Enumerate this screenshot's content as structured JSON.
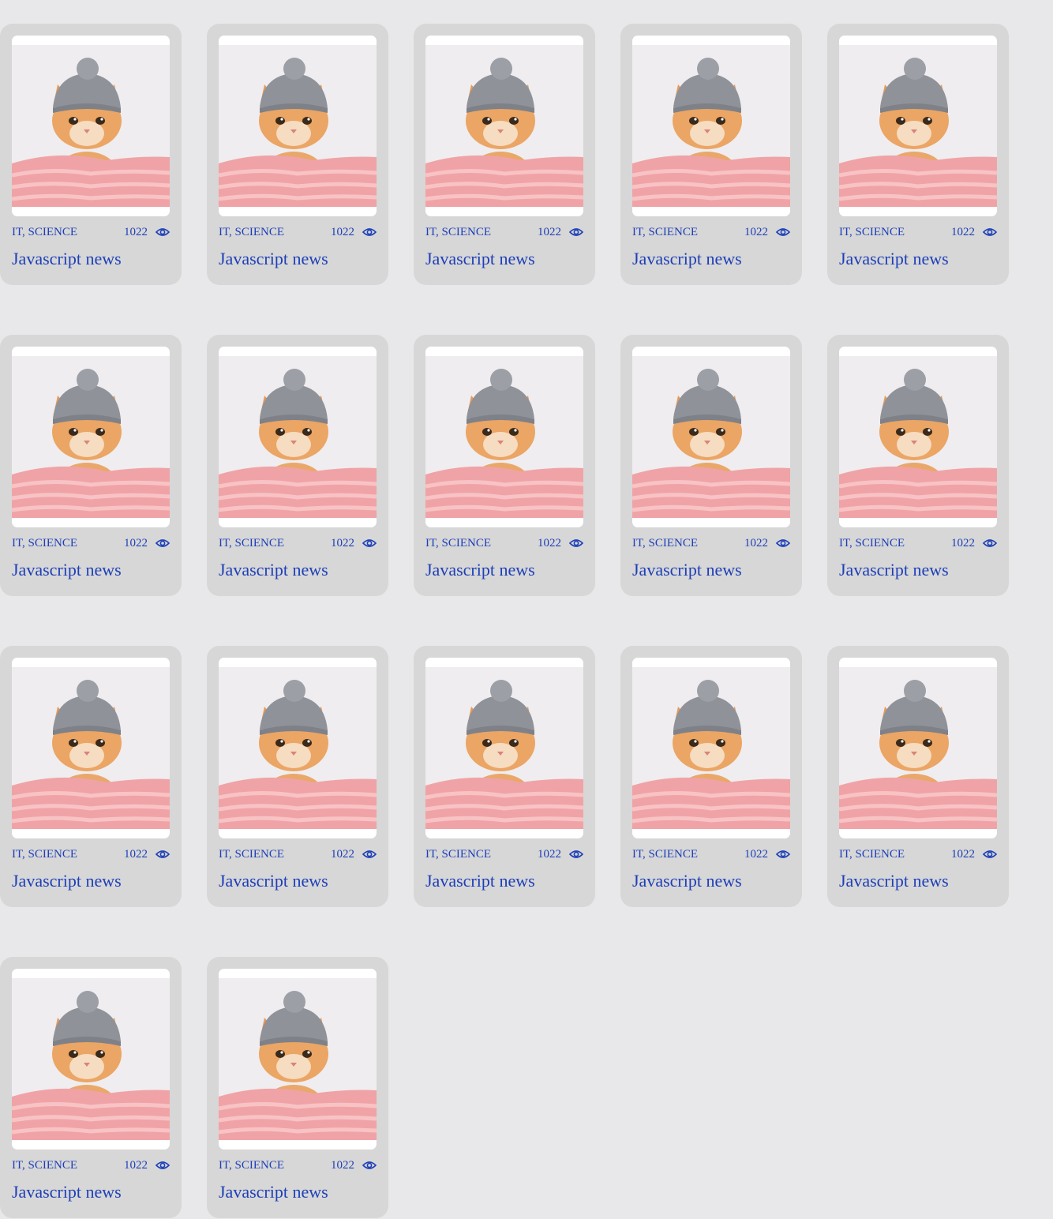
{
  "colors": {
    "page_background": "#e8e8ea",
    "card_background": "#d7d7d7",
    "link_blue": "#1d3fb8"
  },
  "cards": [
    {
      "image": "kitten-in-knit-hat-photo",
      "categories": "IT, SCIENCE",
      "views": "1022",
      "views_icon": "eye-icon",
      "title": "Javascript news"
    },
    {
      "image": "kitten-in-knit-hat-photo",
      "categories": "IT, SCIENCE",
      "views": "1022",
      "views_icon": "eye-icon",
      "title": "Javascript news"
    },
    {
      "image": "kitten-in-knit-hat-photo",
      "categories": "IT, SCIENCE",
      "views": "1022",
      "views_icon": "eye-icon",
      "title": "Javascript news"
    },
    {
      "image": "kitten-in-knit-hat-photo",
      "categories": "IT, SCIENCE",
      "views": "1022",
      "views_icon": "eye-icon",
      "title": "Javascript news"
    },
    {
      "image": "kitten-in-knit-hat-photo",
      "categories": "IT, SCIENCE",
      "views": "1022",
      "views_icon": "eye-icon",
      "title": "Javascript news"
    },
    {
      "image": "kitten-in-knit-hat-photo",
      "categories": "IT, SCIENCE",
      "views": "1022",
      "views_icon": "eye-icon",
      "title": "Javascript news"
    },
    {
      "image": "kitten-in-knit-hat-photo",
      "categories": "IT, SCIENCE",
      "views": "1022",
      "views_icon": "eye-icon",
      "title": "Javascript news"
    },
    {
      "image": "kitten-in-knit-hat-photo",
      "categories": "IT, SCIENCE",
      "views": "1022",
      "views_icon": "eye-icon",
      "title": "Javascript news"
    },
    {
      "image": "kitten-in-knit-hat-photo",
      "categories": "IT, SCIENCE",
      "views": "1022",
      "views_icon": "eye-icon",
      "title": "Javascript news"
    },
    {
      "image": "kitten-in-knit-hat-photo",
      "categories": "IT, SCIENCE",
      "views": "1022",
      "views_icon": "eye-icon",
      "title": "Javascript news"
    },
    {
      "image": "kitten-in-knit-hat-photo",
      "categories": "IT, SCIENCE",
      "views": "1022",
      "views_icon": "eye-icon",
      "title": "Javascript news"
    },
    {
      "image": "kitten-in-knit-hat-photo",
      "categories": "IT, SCIENCE",
      "views": "1022",
      "views_icon": "eye-icon",
      "title": "Javascript news"
    },
    {
      "image": "kitten-in-knit-hat-photo",
      "categories": "IT, SCIENCE",
      "views": "1022",
      "views_icon": "eye-icon",
      "title": "Javascript news"
    },
    {
      "image": "kitten-in-knit-hat-photo",
      "categories": "IT, SCIENCE",
      "views": "1022",
      "views_icon": "eye-icon",
      "title": "Javascript news"
    },
    {
      "image": "kitten-in-knit-hat-photo",
      "categories": "IT, SCIENCE",
      "views": "1022",
      "views_icon": "eye-icon",
      "title": "Javascript news"
    },
    {
      "image": "kitten-in-knit-hat-photo",
      "categories": "IT, SCIENCE",
      "views": "1022",
      "views_icon": "eye-icon",
      "title": "Javascript news"
    },
    {
      "image": "kitten-in-knit-hat-photo",
      "categories": "IT, SCIENCE",
      "views": "1022",
      "views_icon": "eye-icon",
      "title": "Javascript news"
    }
  ]
}
